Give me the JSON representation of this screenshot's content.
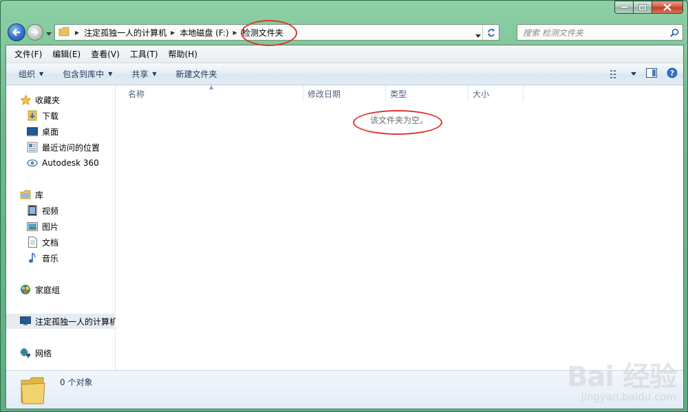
{
  "navigation": {
    "breadcrumbs": [
      "注定孤独一人的计算机",
      "本地磁盘 (F:)",
      "检测文件夹"
    ],
    "search_placeholder": "搜索 检测文件夹"
  },
  "menu": [
    "文件(F)",
    "编辑(E)",
    "查看(V)",
    "工具(T)",
    "帮助(H)"
  ],
  "toolbar": {
    "organize": "组织",
    "include_library": "包含到库中",
    "share": "共享",
    "new_folder": "新建文件夹"
  },
  "sidebar": {
    "favorites": {
      "label": "收藏夹",
      "items": [
        "下载",
        "桌面",
        "最近访问的位置",
        "Autodesk 360"
      ]
    },
    "libraries": {
      "label": "库",
      "items": [
        "视频",
        "图片",
        "文档",
        "音乐"
      ]
    },
    "homegroup": "家庭组",
    "computer": "注定孤独一人的计算机",
    "network": "网络"
  },
  "columns": [
    "名称",
    "修改日期",
    "类型",
    "大小"
  ],
  "empty_message": "该文件夹为空。",
  "details": {
    "count": "0 个对象"
  },
  "watermark": {
    "brand": "Bai 经验",
    "url": "jingyan.baidu.com"
  },
  "colors": {
    "annotation": "#e0322b",
    "frame": "#6cb98c",
    "link_text": "#1e395b"
  }
}
